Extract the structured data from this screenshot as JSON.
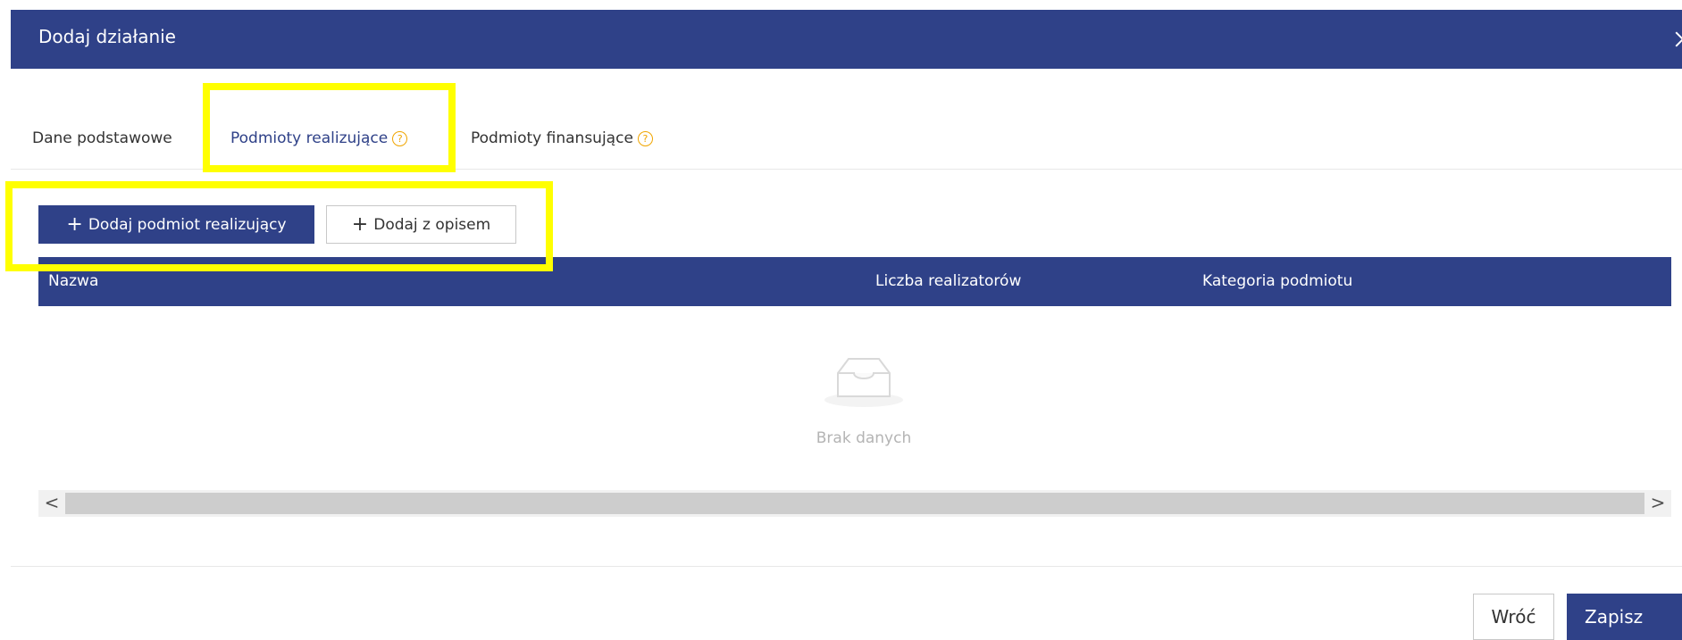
{
  "modal": {
    "title": "Dodaj działanie",
    "close_icon": "close-icon"
  },
  "tabs": [
    {
      "label": "Dane podstawowe",
      "active": false
    },
    {
      "label": "Podmioty realizujące",
      "active": true,
      "help_icon": "?"
    },
    {
      "label": "Podmioty finansujące",
      "active": false,
      "help_icon": "?"
    }
  ],
  "toolbar": {
    "add_entity_label": "Dodaj podmiot realizujący",
    "add_with_description_label": "Dodaj z opisem",
    "plus_glyph": "+"
  },
  "table": {
    "columns": [
      "Nazwa",
      "Liczba realizatorów",
      "Kategoria podmiotu"
    ],
    "rows": [],
    "empty_text": "Brak danych"
  },
  "scrollbar": {
    "left_arrow": "<",
    "right_arrow": ">"
  },
  "footer": {
    "back_label": "Wróć",
    "save_label": "Zapisz"
  },
  "colors": {
    "primary": "#2f4188",
    "help_icon": "#f0a500",
    "highlight": "#ffff00"
  }
}
